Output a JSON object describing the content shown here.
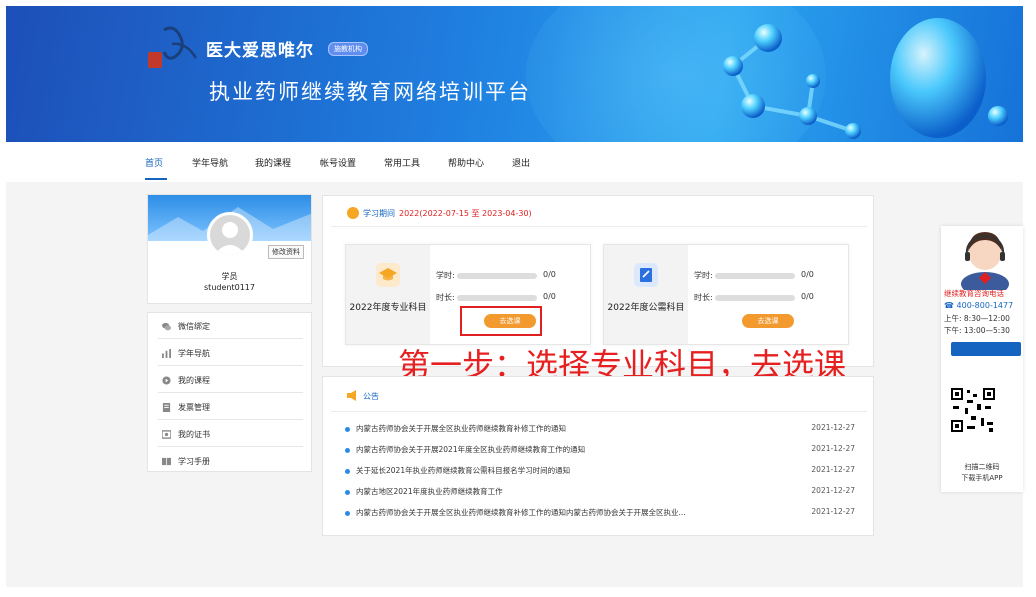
{
  "header": {
    "brand": "医大爱思唯尔",
    "badge": "施教机构",
    "platform": "执业药师继续教育网络培训平台"
  },
  "nav": {
    "items": [
      "首页",
      "学年导航",
      "我的课程",
      "帐号设置",
      "常用工具",
      "帮助中心",
      "退出"
    ],
    "active": "首页"
  },
  "profile": {
    "edit_label": "修改资料",
    "role": "学员",
    "username": "student0117"
  },
  "menu": {
    "items": [
      {
        "label": "微信绑定",
        "icon": "wechat-icon"
      },
      {
        "label": "学年导航",
        "icon": "chart-icon"
      },
      {
        "label": "我的课程",
        "icon": "course-icon"
      },
      {
        "label": "发票管理",
        "icon": "invoice-icon"
      },
      {
        "label": "我的证书",
        "icon": "certificate-icon"
      },
      {
        "label": "学习手册",
        "icon": "manual-icon"
      }
    ]
  },
  "study": {
    "heading": "学习期间",
    "period": "2022(2022-07-15 至 2023-04-30)",
    "cards": [
      {
        "name": "2022年度专业科目",
        "icon": "graduation-cap-icon",
        "hours_label": "学时:",
        "hours_value": "0/0",
        "hours_progress": 0,
        "duration_label": "时长:",
        "duration_value": "0/0",
        "duration_progress": 0,
        "button": "去选课",
        "icon_color": "#f5a623"
      },
      {
        "name": "2022年度公需科目",
        "icon": "edit-note-icon",
        "hours_label": "学时:",
        "hours_value": "0/0",
        "hours_progress": 0,
        "duration_label": "时长:",
        "duration_value": "0/0",
        "duration_progress": 0,
        "button": "去选课",
        "icon_color": "#2b6fe0"
      }
    ]
  },
  "annotation": "第一步：选择专业科目，去选课",
  "notice": {
    "heading": "公告",
    "items": [
      {
        "title": "内蒙古药师协会关于开展全区执业药师继续教育补修工作的通知",
        "date": "2021-12-27"
      },
      {
        "title": "内蒙古药师协会关于开展2021年度全区执业药师继续教育工作的通知",
        "date": "2021-12-27"
      },
      {
        "title": "关于延长2021年执业药师继续教育公需科目报名学习时间的通知",
        "date": "2021-12-27"
      },
      {
        "title": "内蒙古地区2021年度执业药师继续教育工作",
        "date": "2021-12-27"
      },
      {
        "title": "内蒙古药师协会关于开展全区执业药师继续教育补修工作的通知内蒙古药师协会关于开展全区执业...",
        "date": "2021-12-27"
      }
    ]
  },
  "side": {
    "hotline_title": "继续教育咨询电话",
    "phone": "400-800-1477",
    "am": "上午: 8:30—12:00",
    "pm": "下午: 13:00—5:30",
    "scan": "扫描二维码",
    "download": "下载手机APP"
  },
  "colors": {
    "primary": "#1565c0",
    "accent": "#f39a2f",
    "alert": "#e02020"
  }
}
